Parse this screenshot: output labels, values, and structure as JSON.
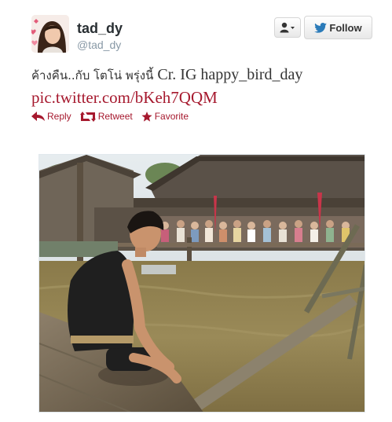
{
  "user": {
    "display_name": "tad_dy",
    "screen_name": "@tad_dy",
    "avatar_icon": "avatar-photo"
  },
  "buttons": {
    "user_dropdown_icon": "person-dropdown-icon",
    "follow_label": "Follow"
  },
  "tweet": {
    "text_thai": "ค้างคืน..กับ โตโน่ พรุ่งนี้",
    "text_latin": " Cr. IG happy_bird_day",
    "link": "pic.twitter.com/bKeh7QQM"
  },
  "actions": {
    "reply": "Reply",
    "retweet": "Retweet",
    "favorite": "Favorite"
  },
  "media": {
    "description_icon": "tweet-photo"
  },
  "colors": {
    "link": "#a6192e",
    "display_name": "#292f33",
    "screen_name": "#8899a6"
  }
}
